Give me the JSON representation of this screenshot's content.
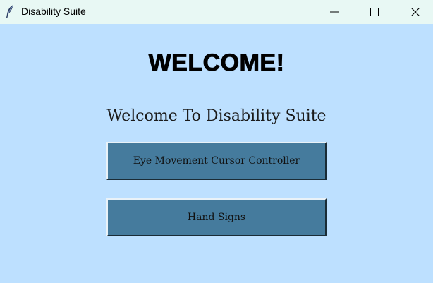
{
  "window": {
    "title": "Disability Suite",
    "controls": {
      "minimize_icon": "minimize-icon",
      "maximize_icon": "maximize-icon",
      "close_icon": "close-icon"
    }
  },
  "main": {
    "heading": "WELCOME!",
    "subtitle": "Welcome To Disability Suite",
    "buttons": [
      {
        "label": "Eye Movement Cursor Controller"
      },
      {
        "label": "Hand Signs"
      }
    ]
  },
  "colors": {
    "background": "#bde0ff",
    "titlebar": "#e8f8f4",
    "button_fill": "#457b9d"
  }
}
